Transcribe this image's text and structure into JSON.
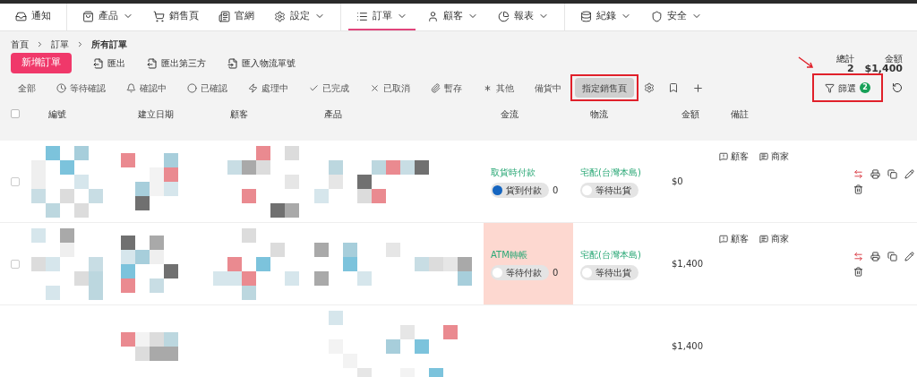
{
  "nav_groups": [
    [
      {
        "label": "通知",
        "dropdown": false,
        "selected": false
      }
    ],
    [
      {
        "label": "產品",
        "dropdown": true,
        "selected": false
      },
      {
        "label": "銷售頁",
        "dropdown": false,
        "selected": false
      },
      {
        "label": "官網",
        "dropdown": false,
        "selected": false
      },
      {
        "label": "設定",
        "dropdown": true,
        "selected": false
      }
    ],
    [
      {
        "label": "訂單",
        "dropdown": true,
        "selected": true
      },
      {
        "label": "顧客",
        "dropdown": true,
        "selected": false
      },
      {
        "label": "報表",
        "dropdown": true,
        "selected": false
      }
    ],
    [
      {
        "label": "紀錄",
        "dropdown": true,
        "selected": false
      },
      {
        "label": "安全",
        "dropdown": true,
        "selected": false
      }
    ]
  ],
  "breadcrumb": [
    "首頁",
    "訂單",
    "所有訂單"
  ],
  "actions": {
    "primary": "新增訂單",
    "links": [
      "匯出",
      "匯出第三方",
      "匯入物流單號"
    ]
  },
  "totals": [
    {
      "label": "總計",
      "value": "2"
    },
    {
      "label": "金額",
      "value": "$1,400"
    }
  ],
  "status_tabs": [
    {
      "label": "全部",
      "selected": false,
      "highlighted": false
    },
    {
      "label": "等待確認",
      "selected": false,
      "highlighted": false
    },
    {
      "label": "確認中",
      "selected": false,
      "highlighted": false
    },
    {
      "label": "已確認",
      "selected": false,
      "highlighted": false
    },
    {
      "label": "處理中",
      "selected": false,
      "highlighted": false
    },
    {
      "label": "已完成",
      "selected": false,
      "highlighted": false
    },
    {
      "label": "已取消",
      "selected": false,
      "highlighted": false
    },
    {
      "label": "暫存",
      "selected": false,
      "highlighted": false
    },
    {
      "label": "其他",
      "selected": false,
      "highlighted": false
    },
    {
      "label": "備貨中",
      "selected": false,
      "highlighted": false
    },
    {
      "label": "指定銷售頁",
      "selected": true,
      "highlighted": true
    }
  ],
  "filter": {
    "label": "篩選",
    "badge": "2",
    "highlighted": true
  },
  "table": {
    "all_checked": false,
    "columns": [
      "編號",
      "建立日期",
      "顧客",
      "產品",
      "金流",
      "物流",
      "金額",
      "備註"
    ],
    "rows": [
      {
        "checked": false,
        "payment": {
          "method": "取貨時付款",
          "status": "貨到付款",
          "on": true,
          "count": "0",
          "alert": false
        },
        "shipping": {
          "method": "宅配(台灣本島)",
          "status": "等待出貨",
          "on": false
        },
        "amount": "$0",
        "notes": [
          "顧客",
          "商家"
        ]
      },
      {
        "checked": false,
        "payment": {
          "method": "ATM轉帳",
          "status": "等待付款",
          "on": false,
          "count": "0",
          "alert": true
        },
        "shipping": {
          "method": "宅配(台灣本島)",
          "status": "等待出貨",
          "on": false
        },
        "amount": "$1,400",
        "notes": [
          "顧客",
          "商家"
        ]
      },
      {
        "amount": "$1,400"
      }
    ]
  }
}
